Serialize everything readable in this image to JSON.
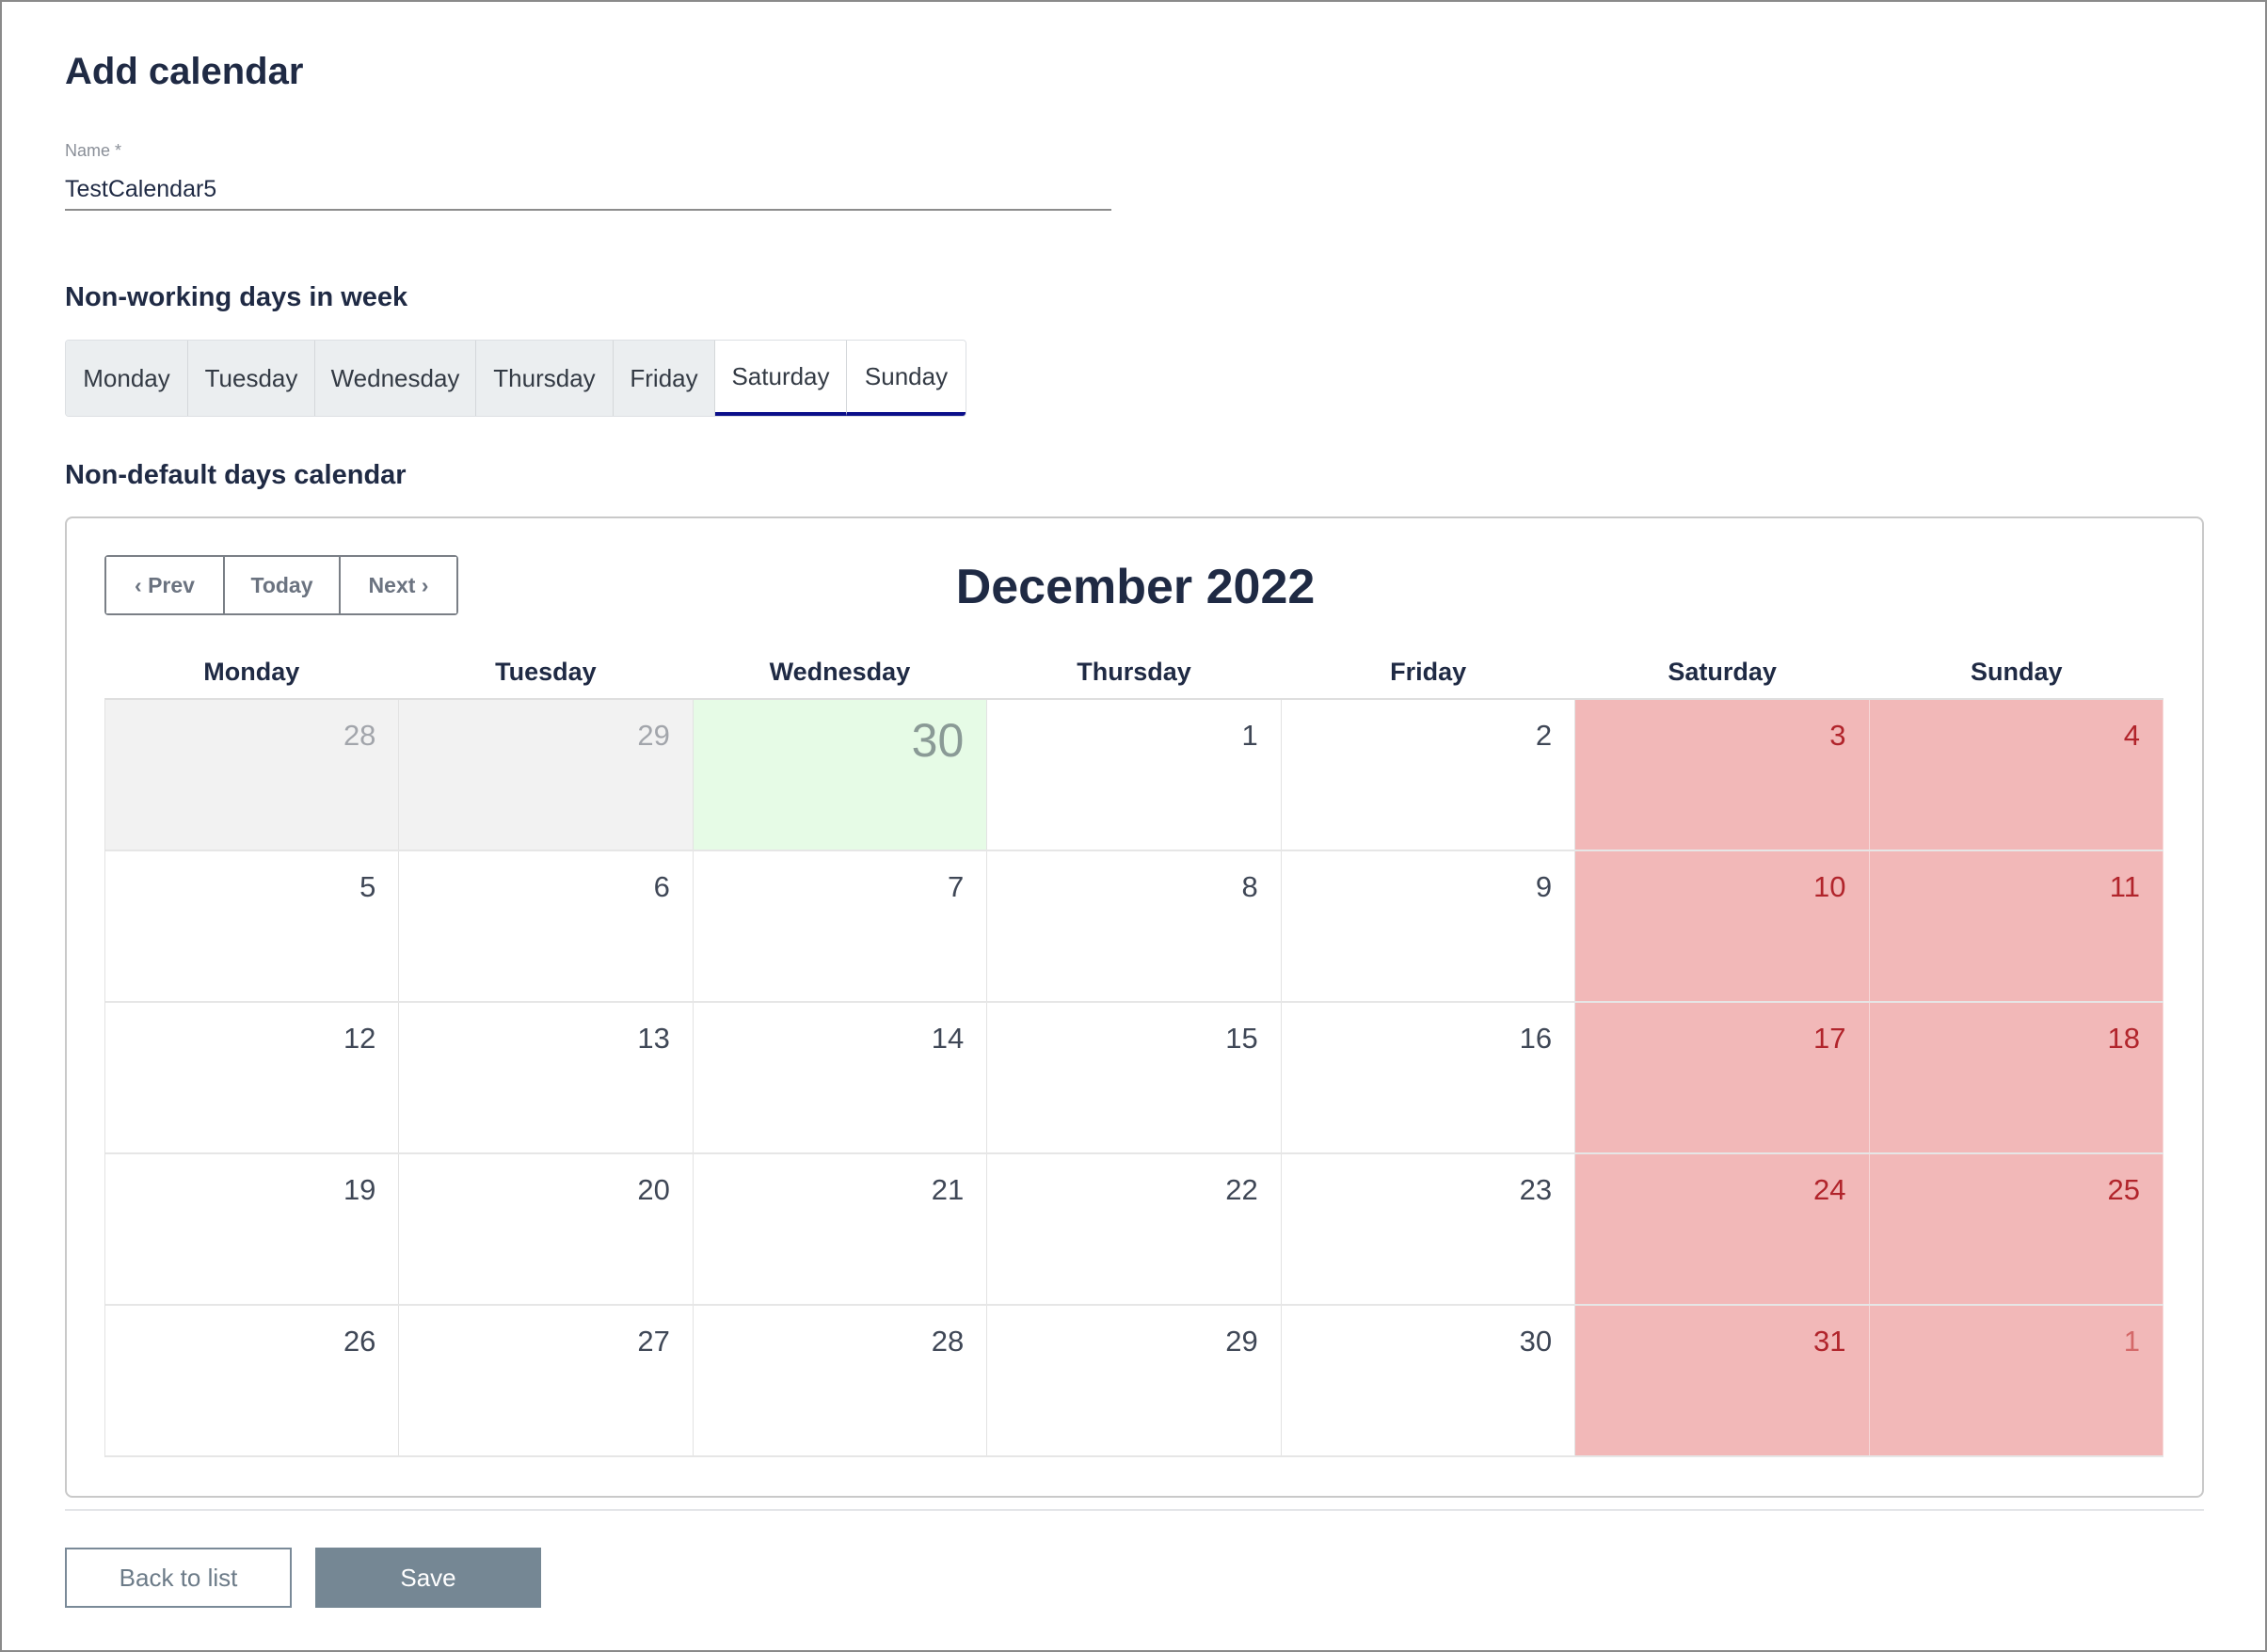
{
  "page": {
    "title": "Add calendar"
  },
  "name_field": {
    "label": "Name *",
    "value": "TestCalendar5"
  },
  "non_working": {
    "title": "Non-working days in week",
    "days": [
      {
        "label": "Monday",
        "selected": false
      },
      {
        "label": "Tuesday",
        "selected": false
      },
      {
        "label": "Wednesday",
        "selected": false
      },
      {
        "label": "Thursday",
        "selected": false
      },
      {
        "label": "Friday",
        "selected": false
      },
      {
        "label": "Saturday",
        "selected": true
      },
      {
        "label": "Sunday",
        "selected": true
      }
    ],
    "selected_color": "#0b0f8a"
  },
  "calendar": {
    "section_title": "Non-default days calendar",
    "nav": {
      "prev": "‹ Prev",
      "today": "Today",
      "next": "Next ›"
    },
    "month_title": "December 2022",
    "weekdays": [
      "Monday",
      "Tuesday",
      "Wednesday",
      "Thursday",
      "Friday",
      "Saturday",
      "Sunday"
    ],
    "weeks": [
      [
        {
          "d": "28",
          "other": true
        },
        {
          "d": "29",
          "other": true
        },
        {
          "d": "30",
          "other": true,
          "today": true
        },
        {
          "d": "1"
        },
        {
          "d": "2"
        },
        {
          "d": "3",
          "off": true
        },
        {
          "d": "4",
          "off": true
        }
      ],
      [
        {
          "d": "5"
        },
        {
          "d": "6"
        },
        {
          "d": "7"
        },
        {
          "d": "8"
        },
        {
          "d": "9"
        },
        {
          "d": "10",
          "off": true
        },
        {
          "d": "11",
          "off": true
        }
      ],
      [
        {
          "d": "12"
        },
        {
          "d": "13"
        },
        {
          "d": "14"
        },
        {
          "d": "15"
        },
        {
          "d": "16"
        },
        {
          "d": "17",
          "off": true
        },
        {
          "d": "18",
          "off": true
        }
      ],
      [
        {
          "d": "19"
        },
        {
          "d": "20"
        },
        {
          "d": "21"
        },
        {
          "d": "22"
        },
        {
          "d": "23"
        },
        {
          "d": "24",
          "off": true
        },
        {
          "d": "25",
          "off": true
        }
      ],
      [
        {
          "d": "26"
        },
        {
          "d": "27"
        },
        {
          "d": "28"
        },
        {
          "d": "29"
        },
        {
          "d": "30"
        },
        {
          "d": "31",
          "off": true
        },
        {
          "d": "1",
          "off": true,
          "other": true
        }
      ]
    ],
    "colors": {
      "off_day_bg": "#f2b8b8",
      "today_bg": "#e6fbe6",
      "other_month_bg": "#f2f2f2"
    }
  },
  "footer": {
    "back_label": "Back to list",
    "save_label": "Save"
  }
}
